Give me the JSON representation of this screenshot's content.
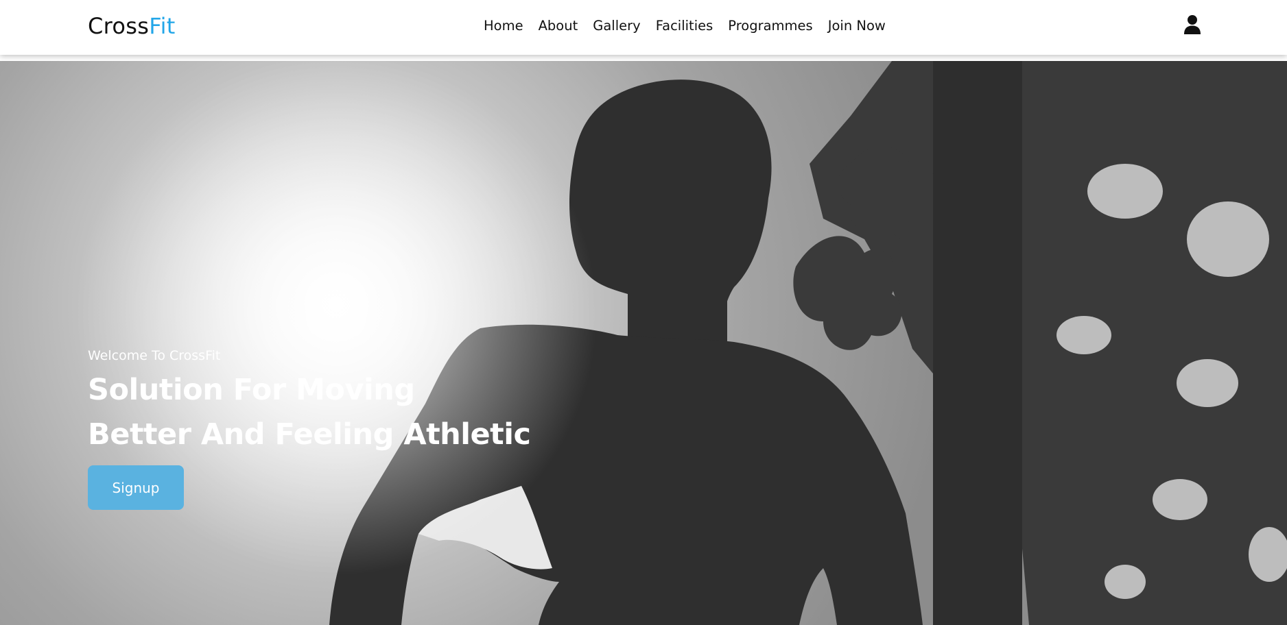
{
  "header": {
    "brand": {
      "prefix": "Cross",
      "accent": "Fit",
      "accent_color": "#22a6e8"
    },
    "nav": [
      {
        "label": "Home"
      },
      {
        "label": "About"
      },
      {
        "label": "Gallery"
      },
      {
        "label": "Facilities"
      },
      {
        "label": "Programmes"
      },
      {
        "label": "Join Now"
      }
    ],
    "user_icon": "user-icon"
  },
  "hero": {
    "background": "grayscale-silhouette-photo",
    "welcome": "Welcome To CrossFit",
    "headline_line1": "Solution For Moving",
    "headline_line2": "Better And Feeling Athletic",
    "cta_label": "Signup",
    "cta_color": "#5ab2e0"
  }
}
